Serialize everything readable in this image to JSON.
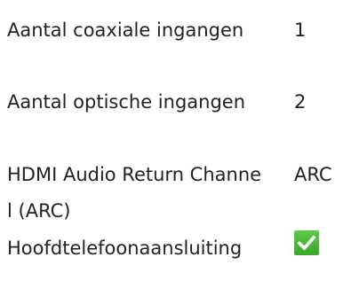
{
  "specs": [
    {
      "label": "Aantal coaxiale ingangen",
      "value": "1"
    },
    {
      "label": "Aantal optische ingangen",
      "value": "2"
    },
    {
      "label": "HDMI Audio Return Channel (ARC)",
      "value": "ARC"
    },
    {
      "label": "Hoofdtelefoonaansluiting",
      "value": "",
      "icon": "checkmark-icon"
    }
  ],
  "colors": {
    "text": "#222222",
    "check_bg": "#4cb83a",
    "check_mark": "#ffffff"
  }
}
